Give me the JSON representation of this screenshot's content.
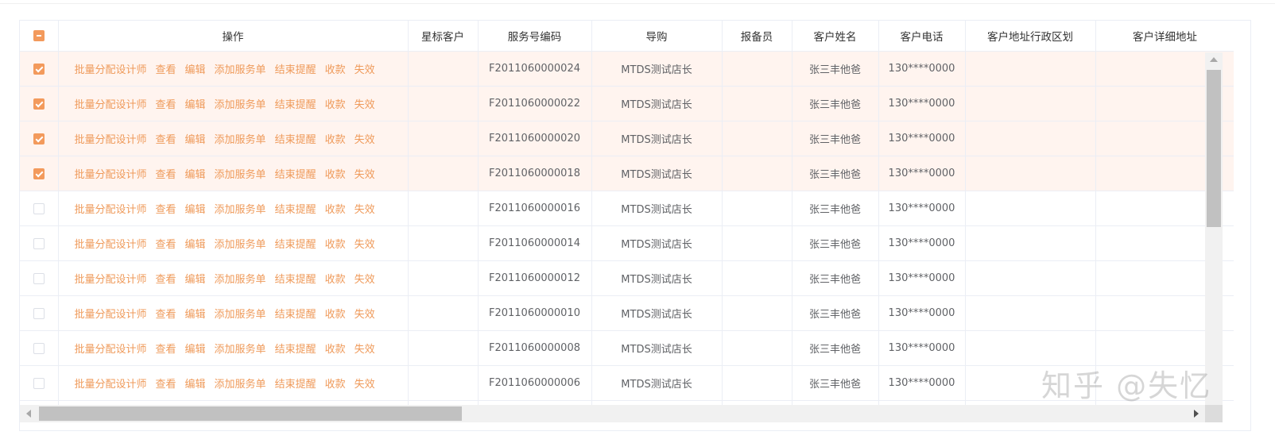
{
  "table": {
    "headers": {
      "ops": "操作",
      "star": "星标客户",
      "service_code": "服务号编码",
      "guide": "导购",
      "reporter": "报备员",
      "customer_name": "客户姓名",
      "customer_phone": "客户电话",
      "region": "客户地址行政区划",
      "address": "客户详细地址"
    },
    "actions": [
      "批量分配设计师",
      "查看",
      "编辑",
      "添加服务单",
      "结束提醒",
      "收款",
      "失效"
    ],
    "rows": [
      {
        "checked": true,
        "service_code": "F2011060000024",
        "guide": "MTDS测试店长",
        "customer_name": "张三丰他爸",
        "customer_phone": "130****0000"
      },
      {
        "checked": true,
        "service_code": "F2011060000022",
        "guide": "MTDS测试店长",
        "customer_name": "张三丰他爸",
        "customer_phone": "130****0000"
      },
      {
        "checked": true,
        "service_code": "F2011060000020",
        "guide": "MTDS测试店长",
        "customer_name": "张三丰他爸",
        "customer_phone": "130****0000"
      },
      {
        "checked": true,
        "service_code": "F2011060000018",
        "guide": "MTDS测试店长",
        "customer_name": "张三丰他爸",
        "customer_phone": "130****0000"
      },
      {
        "checked": false,
        "service_code": "F2011060000016",
        "guide": "MTDS测试店长",
        "customer_name": "张三丰他爸",
        "customer_phone": "130****0000"
      },
      {
        "checked": false,
        "service_code": "F2011060000014",
        "guide": "MTDS测试店长",
        "customer_name": "张三丰他爸",
        "customer_phone": "130****0000"
      },
      {
        "checked": false,
        "service_code": "F2011060000012",
        "guide": "MTDS测试店长",
        "customer_name": "张三丰他爸",
        "customer_phone": "130****0000"
      },
      {
        "checked": false,
        "service_code": "F2011060000010",
        "guide": "MTDS测试店长",
        "customer_name": "张三丰他爸",
        "customer_phone": "130****0000"
      },
      {
        "checked": false,
        "service_code": "F2011060000008",
        "guide": "MTDS测试店长",
        "customer_name": "张三丰他爸",
        "customer_phone": "130****0000"
      },
      {
        "checked": false,
        "service_code": "F2011060000006",
        "guide": "MTDS测试店长",
        "customer_name": "张三丰他爸",
        "customer_phone": "130****0000"
      }
    ]
  },
  "colors": {
    "accent": "#ef9a5a",
    "checkbox": "#f39a5c",
    "selected_row": "#fff4ef",
    "border": "#ebeef5"
  },
  "icons": {
    "header_checkbox": "indeterminate-checkbox-icon",
    "row_checkbox": "checkbox-icon",
    "scroll_up": "triangle-up-icon",
    "scroll_down": "triangle-down-icon",
    "scroll_left": "triangle-left-icon",
    "scroll_right": "triangle-right-icon"
  },
  "watermark": "知乎 @失忆"
}
